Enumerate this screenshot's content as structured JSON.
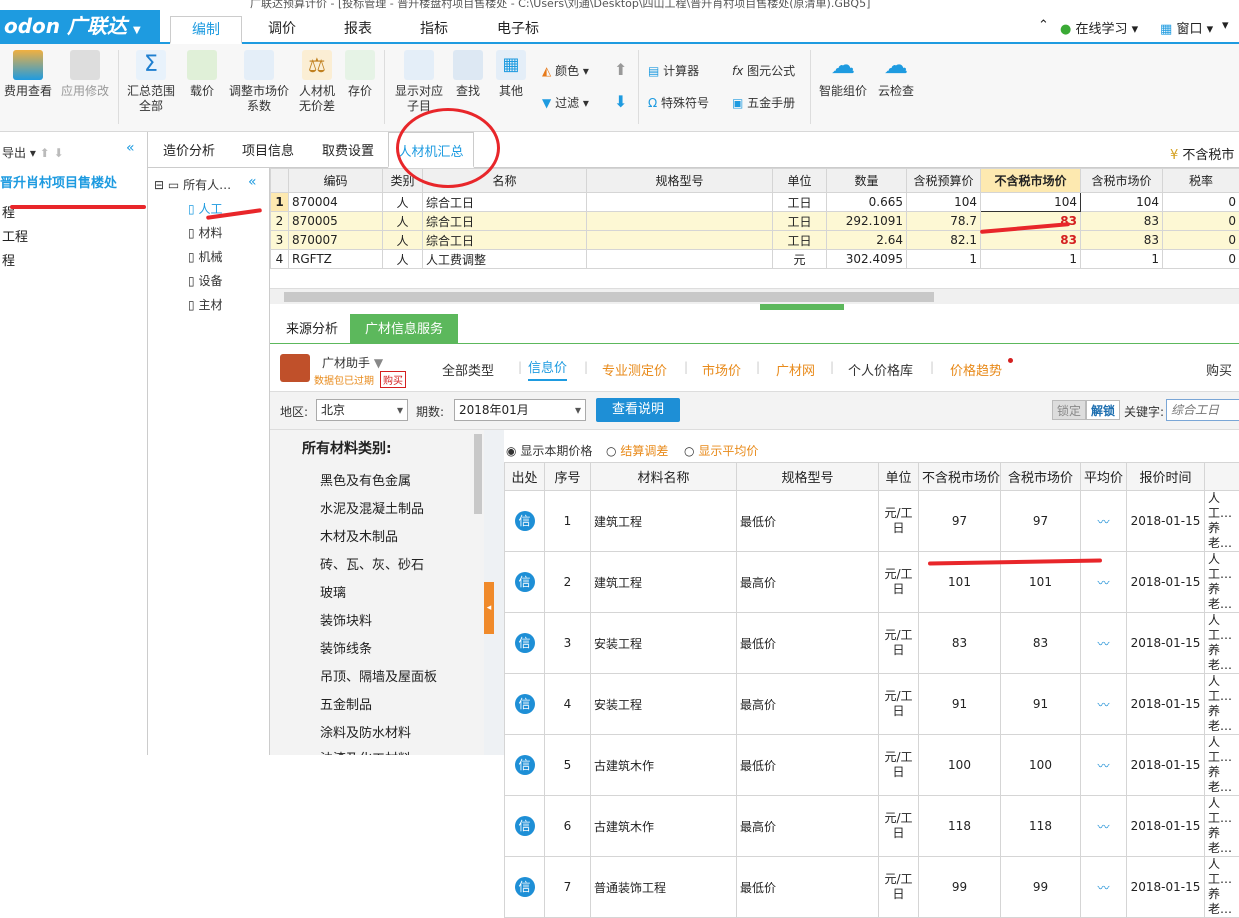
{
  "title": "广联达预算计价 - [投标管理 - 晋升楼盘村项目售楼处 - C:\\Users\\刘通\\Desktop\\四山工程\\晋升肖村项目售楼处(原清单).GBQ5]",
  "brand": "odon 广联达",
  "menu": [
    "编制",
    "调价",
    "报表",
    "指标",
    "电子标"
  ],
  "menu_right": {
    "online": "在线学习",
    "window": "窗口"
  },
  "toolbar": {
    "b1": "费用查看",
    "b2": "应用修改",
    "b3": "汇总范围",
    "b3b": "全部",
    "b4": "载价",
    "b5": "调整市场价",
    "b5b": "系数",
    "b6": "人材机",
    "b6b": "无价差",
    "b7": "存价",
    "b8": "显示对应",
    "b8b": "子目",
    "b9": "查找",
    "b10": "其他",
    "color": "颜色",
    "filter": "过滤",
    "calc": "计算器",
    "formula": "图元公式",
    "special": "特殊符号",
    "hardware": "五金手册",
    "smart": "智能组价",
    "cloud": "云检查"
  },
  "left": {
    "export": "导出",
    "project": "晋升肖村项目售楼处",
    "items": [
      "程",
      "工程",
      "程"
    ]
  },
  "tree": {
    "root": "所有人…",
    "items": [
      "人工",
      "材料",
      "机械",
      "设备",
      "主材"
    ]
  },
  "ptabs": [
    "造价分析",
    "项目信息",
    "取费设置",
    "人材机汇总"
  ],
  "tax_toggle": "不含税市",
  "grid": {
    "headers": [
      "编码",
      "类别",
      "名称",
      "规格型号",
      "单位",
      "数量",
      "含税预算价",
      "不含税市场价",
      "含税市场价",
      "税率"
    ],
    "rows": [
      {
        "no": "1",
        "code": "870004",
        "type": "人",
        "name": "综合工日",
        "spec": "",
        "unit": "工日",
        "qty": "0.665",
        "budget": "104",
        "market": "104",
        "taxmarket": "104",
        "rate": "0"
      },
      {
        "no": "2",
        "code": "870005",
        "type": "人",
        "name": "综合工日",
        "spec": "",
        "unit": "工日",
        "qty": "292.1091",
        "budget": "78.7",
        "market": "83",
        "taxmarket": "83",
        "rate": "0"
      },
      {
        "no": "3",
        "code": "870007",
        "type": "人",
        "name": "综合工日",
        "spec": "",
        "unit": "工日",
        "qty": "2.64",
        "budget": "82.1",
        "market": "83",
        "taxmarket": "83",
        "rate": "0"
      },
      {
        "no": "4",
        "code": "RGFTZ",
        "type": "人",
        "name": "人工费调整",
        "spec": "",
        "unit": "元",
        "qty": "302.4095",
        "budget": "1",
        "market": "1",
        "taxmarket": "1",
        "rate": "0"
      }
    ]
  },
  "btabs": [
    "来源分析",
    "广材信息服务"
  ],
  "svc": {
    "helper": "广材助手",
    "expired": "数据包已过期",
    "buy": "购买",
    "types": [
      "全部类型",
      "信息价",
      "专业测定价",
      "市场价",
      "广材网",
      "个人价格库",
      "价格趋势"
    ],
    "buy_right": "购买"
  },
  "filter": {
    "region_label": "地区:",
    "region": "北京",
    "period_label": "期数:",
    "period": "2018年01月",
    "explain": "查看说明",
    "lock": "锁定",
    "unlock": "解锁",
    "keyword_label": "关键字:",
    "keyword_placeholder": "综合工日"
  },
  "cat": {
    "title": "所有材料类别:",
    "items": [
      "黑色及有色金属",
      "水泥及混凝土制品",
      "木材及木制品",
      "砖、瓦、灰、砂石",
      "玻璃",
      "装饰块料",
      "装饰线条",
      "吊顶、隔墙及屋面板",
      "五金制品",
      "涂料及防水材料",
      "油漆及化工材料"
    ]
  },
  "radios": [
    "显示本期价格",
    "结算调差",
    "显示平均价"
  ],
  "price": {
    "headers": [
      "出处",
      "序号",
      "材料名称",
      "规格型号",
      "单位",
      "不含税市场价",
      "含税市场价",
      "平均价",
      "报价时间",
      ""
    ],
    "rows": [
      {
        "src": "信",
        "no": "1",
        "name": "建筑工程",
        "spec": "最低价",
        "unit": "元/工日",
        "p1": "97",
        "p2": "97",
        "date": "2018-01-15",
        "note": "人工…养老…"
      },
      {
        "src": "信",
        "no": "2",
        "name": "建筑工程",
        "spec": "最高价",
        "unit": "元/工日",
        "p1": "101",
        "p2": "101",
        "date": "2018-01-15",
        "note": "人工…养老…"
      },
      {
        "src": "信",
        "no": "3",
        "name": "安装工程",
        "spec": "最低价",
        "unit": "元/工日",
        "p1": "83",
        "p2": "83",
        "date": "2018-01-15",
        "note": "人工…养老…"
      },
      {
        "src": "信",
        "no": "4",
        "name": "安装工程",
        "spec": "最高价",
        "unit": "元/工日",
        "p1": "91",
        "p2": "91",
        "date": "2018-01-15",
        "note": "人工…养老…"
      },
      {
        "src": "信",
        "no": "5",
        "name": "古建筑木作",
        "spec": "最低价",
        "unit": "元/工日",
        "p1": "100",
        "p2": "100",
        "date": "2018-01-15",
        "note": "人工…养老…"
      },
      {
        "src": "信",
        "no": "6",
        "name": "古建筑木作",
        "spec": "最高价",
        "unit": "元/工日",
        "p1": "118",
        "p2": "118",
        "date": "2018-01-15",
        "note": "人工…养老…"
      },
      {
        "src": "信",
        "no": "7",
        "name": "普通装饰工程",
        "spec": "最低价",
        "unit": "元/工日",
        "p1": "99",
        "p2": "99",
        "date": "2018-01-15",
        "note": "人工…养老…"
      }
    ]
  },
  "colors": {
    "accent": "#1e9be0",
    "green": "#5cb85c",
    "orange": "#e88a1a",
    "annotation": "#e8262a"
  }
}
